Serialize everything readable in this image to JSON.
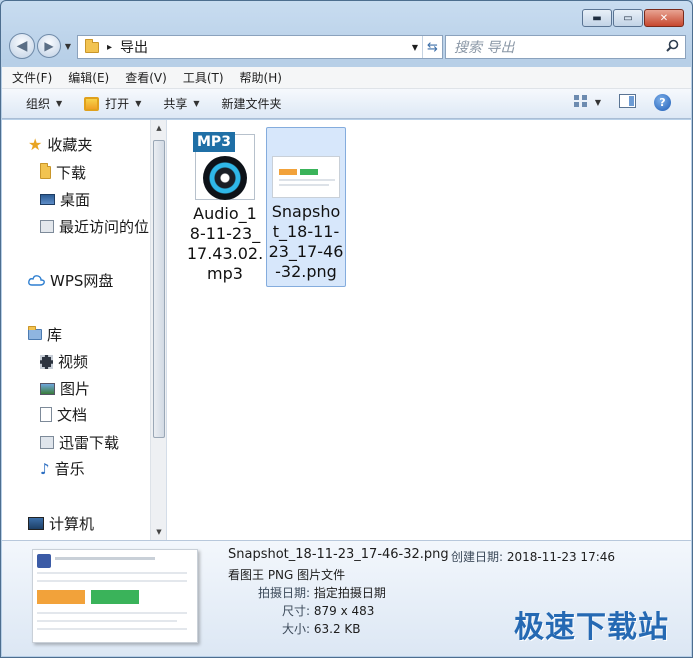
{
  "window": {
    "caption": {
      "minimize": "▬",
      "maximize": "▭",
      "close": "✕"
    }
  },
  "address": {
    "separator": "▸",
    "folder": "导出",
    "dropdown": "▼",
    "refresh": "⇆"
  },
  "search": {
    "placeholder": "搜索 导出"
  },
  "menu": [
    {
      "label": "文件(F)"
    },
    {
      "label": "编辑(E)"
    },
    {
      "label": "查看(V)"
    },
    {
      "label": "工具(T)"
    },
    {
      "label": "帮助(H)"
    }
  ],
  "toolbar": {
    "organize": "组织",
    "open": "打开",
    "share": "共享",
    "new_folder": "新建文件夹",
    "help": "?"
  },
  "nav": {
    "favorites": "收藏夹",
    "downloads": "下载",
    "desktop": "桌面",
    "recent": "最近访问的位",
    "wps": "WPS网盘",
    "libraries": "库",
    "videos": "视频",
    "pictures": "图片",
    "documents": "文档",
    "xunlei": "迅雷下载",
    "music": "音乐",
    "computer": "计算机"
  },
  "files": [
    {
      "name": "Audio_18-11-23_17.43.02.mp3",
      "lines": [
        "Audio_1",
        "8-11-23_",
        "17.43.02.",
        "mp3"
      ],
      "badge": "MP3"
    },
    {
      "name": "Snapshot_18-11-23_17-46-32.png",
      "lines": [
        "Snapsho",
        "t_18-11-",
        "23_17-46",
        "-32.png"
      ]
    }
  ],
  "details": {
    "filename": "Snapshot_18-11-23_17-46-32.png",
    "created_label": "创建日期:",
    "created_value": "2018-11-23 17:46",
    "type": "看图王 PNG 图片文件",
    "taken_label": "拍摄日期:",
    "taken_value": "指定拍摄日期",
    "dims_label": "尺寸:",
    "dims_value": "879 x 483",
    "size_label": "大小:",
    "size_value": "63.2 KB"
  },
  "watermark": "极速下载站"
}
